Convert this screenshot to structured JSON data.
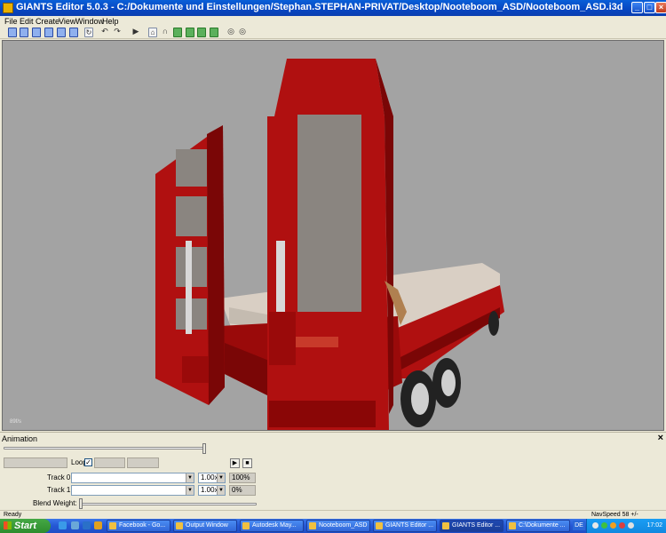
{
  "window": {
    "title": "GIANTS Editor 5.0.3 - C:/Dokumente und Einstellungen/Stephan.STEPHAN-PRIVAT/Desktop/Nooteboom_ASD/Nooteboom_ASD.i3d",
    "minimize_icon": "minimize-icon",
    "maximize_icon": "maximize-icon",
    "close_icon": "close-icon"
  },
  "menu": [
    "File",
    "Edit",
    "Create",
    "View",
    "Window",
    "Help"
  ],
  "toolbar": {
    "icons": [
      "new-file-icon",
      "open-file-icon",
      "import-icon",
      "export-icon",
      "save-icon",
      "save-as-icon",
      "refresh-icon",
      "undo-icon",
      "redo-icon",
      "play-icon",
      "home-icon",
      "camera-icon",
      "terrain-icon",
      "terrain-paint-icon",
      "foliage-icon",
      "foliage-paint-icon",
      "snap-icon",
      "select-icon"
    ]
  },
  "viewport": {
    "fps_text": "89f/s",
    "background": "#a3a3a3",
    "trailer_color": "#b01010",
    "trailer_dark": "#7a0606"
  },
  "animation": {
    "header": "Animation",
    "close_label": "×",
    "loop_label": "Loop",
    "loop_checked": true,
    "loop_mark": "✓",
    "play_icon": "play-icon",
    "stop_icon": "stop-icon",
    "tracks": [
      {
        "label": "Track 0:",
        "clip": "",
        "speed": "1.00x",
        "weight": "100%"
      },
      {
        "label": "Track 1:",
        "clip": "",
        "speed": "1.00x",
        "weight": "0%"
      }
    ],
    "blend_weight_label": "Blend Weight:",
    "dropdown_arrow": "▼"
  },
  "status": {
    "left": "Ready",
    "right": "NavSpeed 58 +/-"
  },
  "taskbar": {
    "start_label": "Start",
    "tasks": [
      {
        "label": "Facebook - Go...",
        "active": false
      },
      {
        "label": "Output Window",
        "active": false
      },
      {
        "label": "Autodesk May...",
        "active": false
      },
      {
        "label": "Nooteboom_ASD",
        "active": false
      },
      {
        "label": "GIANTS Editor ...",
        "active": false
      },
      {
        "label": "GIANTS Editor ...",
        "active": true
      },
      {
        "label": "C:\\Dokumente ...",
        "active": false
      }
    ],
    "language": "DE",
    "clock": "17:02"
  }
}
